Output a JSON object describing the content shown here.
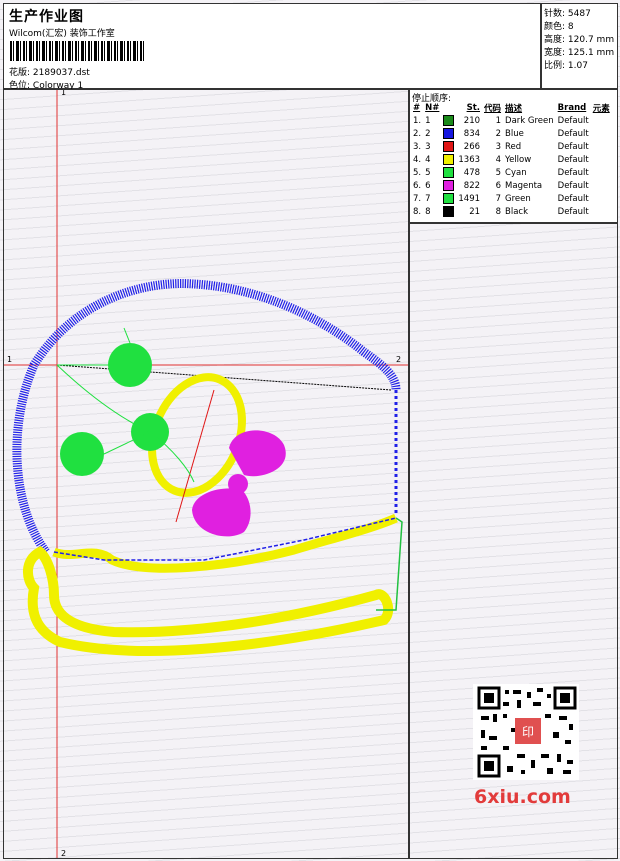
{
  "header": {
    "title": "生产作业图",
    "studio": "Wilcom(汇宏) 装饰工作室",
    "design_label": "花版:",
    "design_value": "2189037.dst",
    "colorway_label": "色位:",
    "colorway_value": "Colorway 1"
  },
  "stats": [
    {
      "label": "针数:",
      "value": "5487"
    },
    {
      "label": "颜色:",
      "value": "8"
    },
    {
      "label": "高度:",
      "value": "120.7 mm"
    },
    {
      "label": "宽度:",
      "value": "125.1 mm"
    },
    {
      "label": "比例:",
      "value": "1.07"
    }
  ],
  "stop_sequence": {
    "title": "停止顺序:",
    "headers": [
      "#",
      "N#",
      "St.",
      "代码",
      "描述",
      "Brand",
      "元素"
    ],
    "rows": [
      {
        "idx": "1.",
        "n": "1",
        "color": "#1a8a1a",
        "st": "210",
        "code": "1",
        "desc": "Dark Green",
        "brand": "Default"
      },
      {
        "idx": "2.",
        "n": "2",
        "color": "#1616e0",
        "st": "834",
        "code": "2",
        "desc": "Blue",
        "brand": "Default"
      },
      {
        "idx": "3.",
        "n": "3",
        "color": "#e01616",
        "st": "266",
        "code": "3",
        "desc": "Red",
        "brand": "Default"
      },
      {
        "idx": "4.",
        "n": "4",
        "color": "#f0f000",
        "st": "1363",
        "code": "4",
        "desc": "Yellow",
        "brand": "Default"
      },
      {
        "idx": "5.",
        "n": "5",
        "color": "#20e040",
        "st": "478",
        "code": "5",
        "desc": "Cyan",
        "brand": "Default"
      },
      {
        "idx": "6.",
        "n": "6",
        "color": "#e020e0",
        "st": "822",
        "code": "6",
        "desc": "Magenta",
        "brand": "Default"
      },
      {
        "idx": "7.",
        "n": "7",
        "color": "#20e040",
        "st": "1491",
        "code": "7",
        "desc": "Green",
        "brand": "Default"
      },
      {
        "idx": "8.",
        "n": "8",
        "color": "#000000",
        "st": "21",
        "code": "8",
        "desc": "Black",
        "brand": "Default"
      }
    ]
  },
  "canvas": {
    "axis_labels": [
      "1",
      "1",
      "2",
      "2"
    ]
  },
  "watermark": {
    "text": "6xiu.com",
    "qr_stamp": "印"
  }
}
